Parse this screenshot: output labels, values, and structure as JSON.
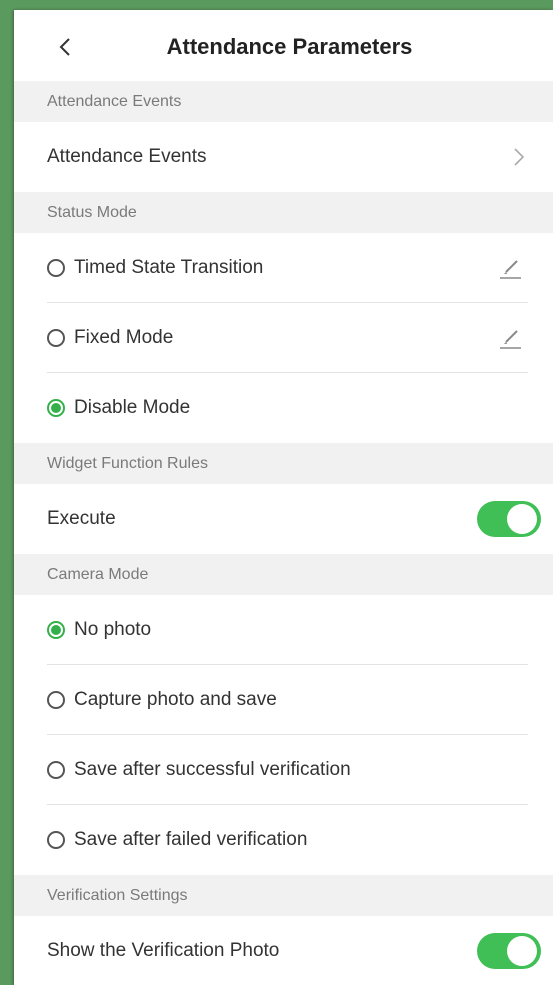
{
  "header": {
    "title": "Attendance Parameters"
  },
  "sections": {
    "attendance_events": "Attendance Events",
    "status_mode": "Status Mode",
    "widget_rules": "Widget Function Rules",
    "camera_mode": "Camera Mode",
    "verification": "Verification Settings"
  },
  "attendance_events_row": "Attendance Events",
  "status_mode_options": [
    {
      "label": "Timed State Transition",
      "selected": false
    },
    {
      "label": "Fixed Mode",
      "selected": false
    },
    {
      "label": "Disable Mode",
      "selected": true
    }
  ],
  "execute": {
    "label": "Execute",
    "on": true
  },
  "camera_mode_options": [
    {
      "label": "No photo",
      "selected": true
    },
    {
      "label": "Capture photo and save",
      "selected": false
    },
    {
      "label": "Save after successful verification",
      "selected": false
    },
    {
      "label": "Save after failed verification",
      "selected": false
    }
  ],
  "show_verification_photo": {
    "label": "Show the Verification Photo",
    "on": true
  },
  "colors": {
    "accent": "#34b04a",
    "toggle_on": "#3fbf55",
    "section_bg": "#f1f1f1"
  },
  "icons": {
    "back": "chevron-left-icon",
    "forward": "chevron-right-icon",
    "edit": "pencil-icon"
  }
}
